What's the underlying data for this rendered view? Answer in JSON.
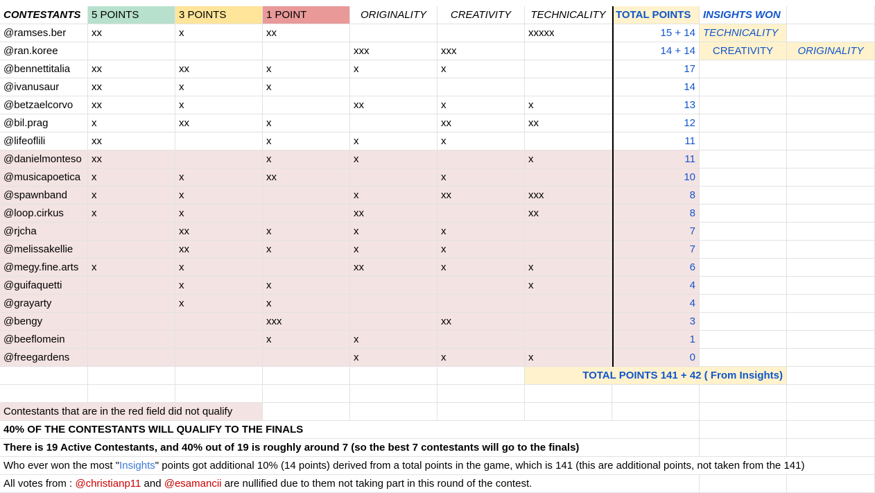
{
  "headers": {
    "contestants": "CONTESTANTS",
    "p5": "5 POINTS",
    "p3": "3 POINTS",
    "p1": "1 POINT",
    "originality": "ORIGINALITY",
    "creativity": "CREATIVITY",
    "technicality": "TECHNICALITY",
    "total": "TOTAL POINTS",
    "insights": "INSIGHTS WON"
  },
  "rows": [
    {
      "name": "@ramses.ber",
      "p5": "xx",
      "p3": "x",
      "p1": "xx",
      "orig": "",
      "crea": "",
      "tech": "xxxxx",
      "total": "15 + 14",
      "ins1": "TECHNICALITY",
      "ins2": ""
    },
    {
      "name": "@ran.koree",
      "p5": "",
      "p3": "",
      "p1": "",
      "orig": "xxx",
      "crea": "xxx",
      "tech": "",
      "total": "14 + 14",
      "ins1": "CREATIVITY",
      "ins2": "ORIGINALITY"
    },
    {
      "name": "@bennettitalia",
      "p5": "xx",
      "p3": "xx",
      "p1": "x",
      "orig": "x",
      "crea": "x",
      "tech": "",
      "total": "17",
      "ins1": "",
      "ins2": ""
    },
    {
      "name": "@ivanusaur",
      "p5": "xx",
      "p3": "x",
      "p1": "x",
      "orig": "",
      "crea": "",
      "tech": "",
      "total": "14",
      "ins1": "",
      "ins2": ""
    },
    {
      "name": "@betzaelcorvo",
      "p5": "xx",
      "p3": "x",
      "p1": "",
      "orig": "xx",
      "crea": "x",
      "tech": "x",
      "total": "13",
      "ins1": "",
      "ins2": ""
    },
    {
      "name": "@bil.prag",
      "p5": "x",
      "p3": "xx",
      "p1": "x",
      "orig": "",
      "crea": "xx",
      "tech": "xx",
      "total": "12",
      "ins1": "",
      "ins2": ""
    },
    {
      "name": "@lifeoflili",
      "p5": "xx",
      "p3": "",
      "p1": "x",
      "orig": "x",
      "crea": "x",
      "tech": "",
      "total": "11",
      "ins1": "",
      "ins2": ""
    },
    {
      "name": "@danielmonteso",
      "p5": "xx",
      "p3": "",
      "p1": "x",
      "orig": "x",
      "crea": "",
      "tech": "x",
      "total": "11",
      "ins1": "",
      "ins2": ""
    },
    {
      "name": "@musicapoetica",
      "p5": "x",
      "p3": "x",
      "p1": "xx",
      "orig": "",
      "crea": "x",
      "tech": "",
      "total": "10",
      "ins1": "",
      "ins2": ""
    },
    {
      "name": "@spawnband",
      "p5": "x",
      "p3": "x",
      "p1": "",
      "orig": "x",
      "crea": "xx",
      "tech": "xxx",
      "total": "8",
      "ins1": "",
      "ins2": ""
    },
    {
      "name": "@loop.cirkus",
      "p5": "x",
      "p3": "x",
      "p1": "",
      "orig": "xx",
      "crea": "",
      "tech": "xx",
      "total": "8",
      "ins1": "",
      "ins2": ""
    },
    {
      "name": "@rjcha",
      "p5": "",
      "p3": "xx",
      "p1": "x",
      "orig": "x",
      "crea": "x",
      "tech": "",
      "total": "7",
      "ins1": "",
      "ins2": ""
    },
    {
      "name": "@melissakellie",
      "p5": "",
      "p3": "xx",
      "p1": "x",
      "orig": "x",
      "crea": "x",
      "tech": "",
      "total": "7",
      "ins1": "",
      "ins2": ""
    },
    {
      "name": "@megy.fine.arts",
      "p5": "x",
      "p3": "x",
      "p1": "",
      "orig": "xx",
      "crea": "x",
      "tech": "x",
      "total": "6",
      "ins1": "",
      "ins2": ""
    },
    {
      "name": "@guifaquetti",
      "p5": "",
      "p3": "x",
      "p1": "x",
      "orig": "",
      "crea": "",
      "tech": "x",
      "total": "4",
      "ins1": "",
      "ins2": ""
    },
    {
      "name": "@grayarty",
      "p5": "",
      "p3": "x",
      "p1": "x",
      "orig": "",
      "crea": "",
      "tech": "",
      "total": "4",
      "ins1": "",
      "ins2": ""
    },
    {
      "name": "@bengy",
      "p5": "",
      "p3": "",
      "p1": "xxx",
      "orig": "",
      "crea": "xx",
      "tech": "",
      "total": "3",
      "ins1": "",
      "ins2": ""
    },
    {
      "name": "@beeflomein",
      "p5": "",
      "p3": "",
      "p1": "x",
      "orig": "x",
      "crea": "",
      "tech": "",
      "total": "1",
      "ins1": "",
      "ins2": ""
    },
    {
      "name": "@freegardens",
      "p5": "",
      "p3": "",
      "p1": "",
      "orig": "x",
      "crea": "x",
      "tech": "x",
      "total": "0",
      "ins1": "",
      "ins2": ""
    }
  ],
  "total_points_summary": "TOTAL POINTS  141 + 42 ( From Insights)",
  "notes": {
    "red_field": "Contestants that are in the red field did not qualify",
    "qualify": "40% OF THE CONTESTANTS WILL QUALIFY TO THE FINALS",
    "active": "There is 19 Active Contestants, and 40% out of 19 is roughly around 7 (so the best 7 contestants will go to the finals)",
    "insights_pre": "Who ever won the most \"",
    "insights_word": "Insights",
    "insights_post": "\" points got additional 10% (14 points) derived from a total points in the game, which is 141 (this are additional points, not taken from the 141)",
    "votes_pre": "All votes from : ",
    "votes_user1": "@christianp11",
    "votes_and": " and ",
    "votes_user2": "@esamancii",
    "votes_post": " are nullified due to them not taking part in this round of the contest."
  },
  "colors": {
    "green": "#b7e1cd",
    "yellow": "#ffe599",
    "red": "#ea9999",
    "not_qualified": "#f4e3e3",
    "insights_bg": "#fff2cc",
    "link_blue": "#1155cc"
  }
}
